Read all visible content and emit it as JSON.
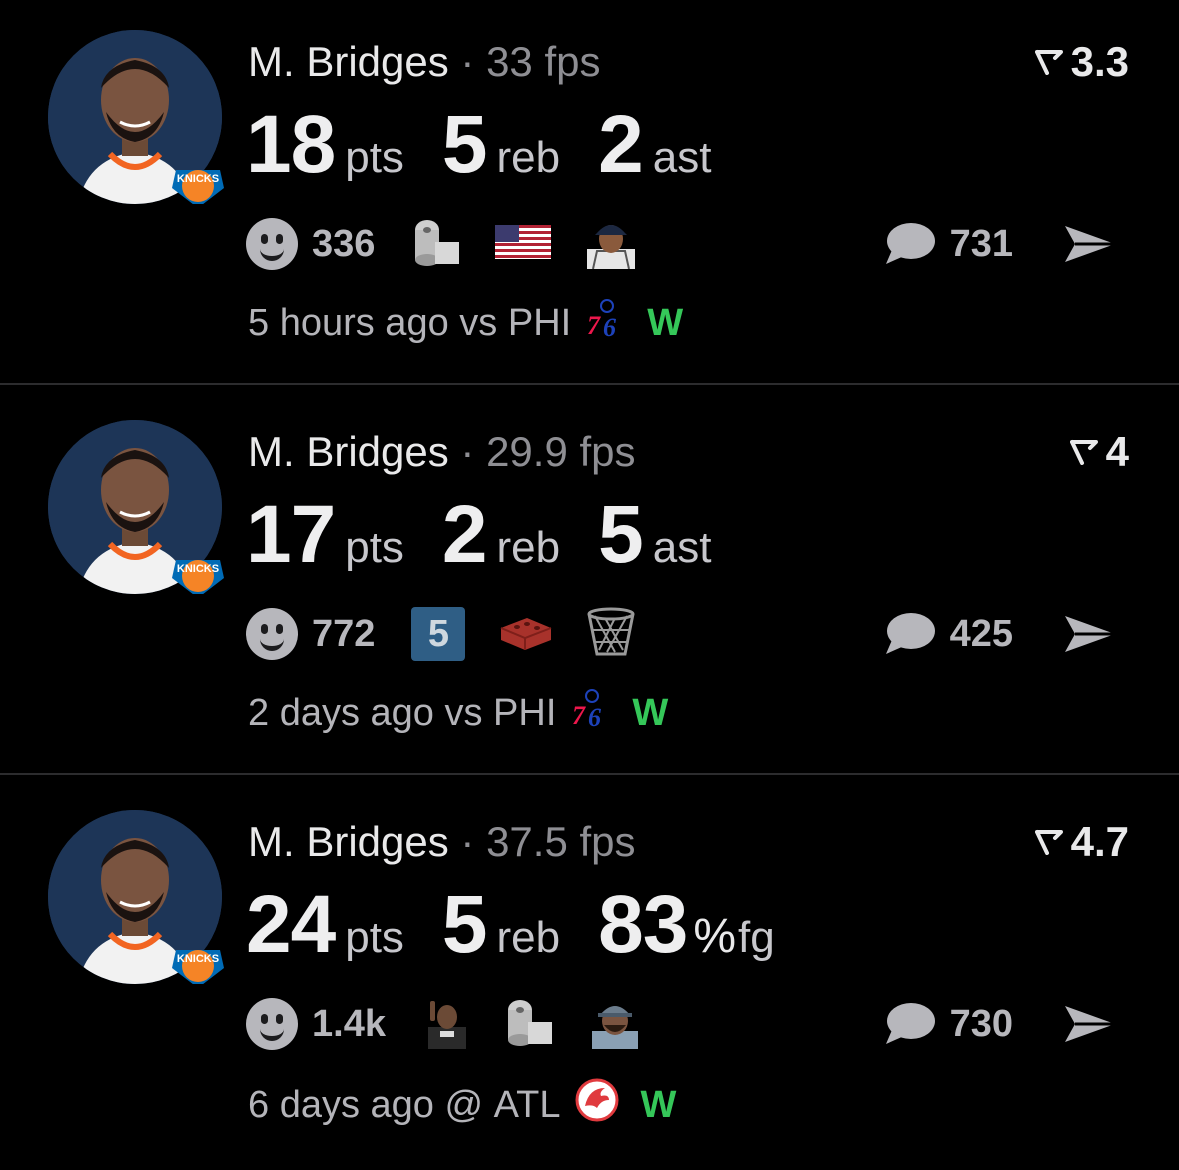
{
  "posts": [
    {
      "player": "M. Bridges",
      "separator": "·",
      "fps": "33 fps",
      "rating": "3.3",
      "stats": [
        {
          "value": "18",
          "unit": "pts"
        },
        {
          "value": "5",
          "unit": "reb"
        },
        {
          "value": "2",
          "unit": "ast"
        }
      ],
      "reaction_count": "336",
      "reaction_emojis": [
        "toilet-paper-icon",
        "us-flag-icon",
        "yankees-player-icon"
      ],
      "comment_count": "731",
      "time": "5 hours ago",
      "opponent_prefix": "vs",
      "opponent": "PHI",
      "opponent_logo": "sixers-logo",
      "result": "W"
    },
    {
      "player": "M. Bridges",
      "separator": "·",
      "fps": "29.9 fps",
      "rating": "4",
      "stats": [
        {
          "value": "17",
          "unit": "pts"
        },
        {
          "value": "2",
          "unit": "reb"
        },
        {
          "value": "5",
          "unit": "ast"
        }
      ],
      "reaction_count": "772",
      "reaction_emojis": [
        "keycap-5-icon",
        "brick-icon",
        "basketball-net-icon"
      ],
      "keycap": "5",
      "comment_count": "425",
      "time": "2 days ago",
      "opponent_prefix": "vs",
      "opponent": "PHI",
      "opponent_logo": "sixers-logo",
      "result": "W"
    },
    {
      "player": "M. Bridges",
      "separator": "·",
      "fps": "37.5 fps",
      "rating": "4.7",
      "stats": [
        {
          "value": "24",
          "unit": "pts"
        },
        {
          "value": "5",
          "unit": "reb"
        },
        {
          "value": "83",
          "pct": "%",
          "unit": "fg"
        }
      ],
      "reaction_count": "1.4k",
      "reaction_emojis": [
        "player-shush-icon",
        "toilet-paper-icon",
        "player-cap-icon"
      ],
      "comment_count": "730",
      "time": "6 days ago",
      "opponent_prefix": "@",
      "opponent": "ATL",
      "opponent_logo": "hawks-logo",
      "result": "W"
    }
  ],
  "colors": {
    "background": "#000000",
    "win": "#35c759",
    "muted": "#8e8e93",
    "avatar_bg": "#1d3557"
  }
}
